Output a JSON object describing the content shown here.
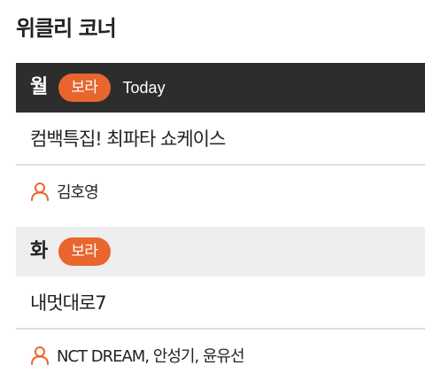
{
  "page": {
    "title": "위클리 코너"
  },
  "days": [
    {
      "day": "월",
      "badge": "보라",
      "today_label": "Today",
      "program": "컴백특집! 최파타 쇼케이스",
      "hosts": "김호영"
    },
    {
      "day": "화",
      "badge": "보라",
      "program": "내멋대로7",
      "hosts": "NCT DREAM, 안성기, 윤유선"
    }
  ],
  "colors": {
    "accent": "#e8662e",
    "today_header_bg": "#2d2d2d",
    "normal_header_bg": "#eeeeee"
  },
  "icons": {
    "host": "person-icon"
  }
}
